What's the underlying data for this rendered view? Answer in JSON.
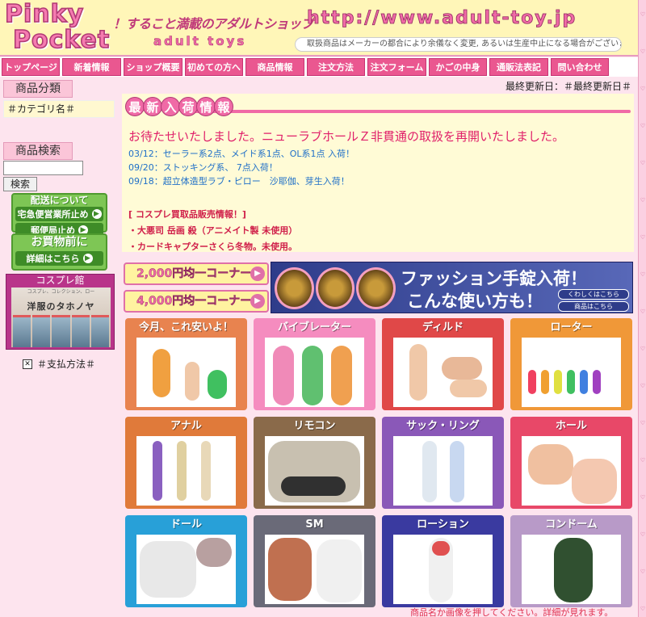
{
  "header": {
    "logo_line1": "Pinky",
    "logo_line2": "Pocket",
    "tagline": "！すること満載のアダルトショップ",
    "brand_sub": "adult toys",
    "url": "http://www.adult-toy.jp",
    "notice": "取扱商品はメーカーの都合により余儀なく変更, あるいは生産中止になる場合がございます。"
  },
  "nav": [
    {
      "label": "トップページ",
      "w": 72
    },
    {
      "label": "新着情報",
      "w": 73
    },
    {
      "label": "ショップ概要",
      "w": 73
    },
    {
      "label": "初めての方へ",
      "w": 72
    },
    {
      "label": "商品情報",
      "w": 73
    },
    {
      "label": "注文方法",
      "w": 72
    },
    {
      "label": "注文フォーム",
      "w": 73
    },
    {
      "label": "かごの中身",
      "w": 72
    },
    {
      "label": "通販法表記",
      "w": 73
    },
    {
      "label": "問い合わせ",
      "w": 72
    }
  ],
  "left": {
    "category_heading": "商品分類",
    "category_placeholder": "＃カテゴリ名＃",
    "search_heading": "商品検索",
    "search_button": "検索",
    "shipping": {
      "title": "配送について",
      "row1": "宅急便営業所止め",
      "row2": "郵便局止め"
    },
    "before": {
      "title": "お買物前に",
      "row": "詳細はこちら"
    },
    "cosplay": {
      "title": "コスプレ館",
      "image_title": "洋服のタホノヤ",
      "image_sub": "コスプレ、コレクション、ロー"
    },
    "payment": "＃支払方法＃"
  },
  "main": {
    "last_updated": "最終更新日：＃最終更新日＃",
    "news_title_chars": [
      "最",
      "新",
      "入",
      "荷",
      "情",
      "報"
    ],
    "news_headline": "お待たせいたしました。ニューラブホールＺ非貫通の取扱を再開いたしました。",
    "news_items": [
      "03/12：セーラー系2点、メイド系1点、OL系1点 入荷！",
      "09/20：ストッキング系、 7点入荷！",
      "09/18：超立体造型ラブ・ピロー　沙耶伽、芽生入荷！"
    ],
    "cosplay_news": [
      "[ コスプレ買取品販売情報！]",
      "・大悪司 岳画 殺（アニメイト製 未使用）",
      "・カードキャプターさくら冬物。未使用。"
    ],
    "corners": [
      "2,000円均一コーナー",
      "4,000円均一コーナー"
    ],
    "fashion_banner": {
      "line1": "ファッション手錠入荷！",
      "line2": "こんな使い方も！",
      "btn1": "くわしくはこちら",
      "btn2": "商品はこちら"
    },
    "categories": [
      {
        "label": "今月、これ安いよ！",
        "color": "#e8834f"
      },
      {
        "label": "バイブレーター",
        "color": "#f58cbf"
      },
      {
        "label": "ディルド",
        "color": "#e04848"
      },
      {
        "label": "ローター",
        "color": "#f09838"
      },
      {
        "label": "アナル",
        "color": "#e07a3a"
      },
      {
        "label": "リモコン",
        "color": "#8a6a4a"
      },
      {
        "label": "サック・リング",
        "color": "#8a58b8"
      },
      {
        "label": "ホール",
        "color": "#e84868"
      },
      {
        "label": "ドール",
        "color": "#28a0d8"
      },
      {
        "label": "SM",
        "color": "#6a6a78"
      },
      {
        "label": "ローション",
        "color": "#3a3aa0"
      },
      {
        "label": "コンドーム",
        "color": "#b89ac8"
      }
    ],
    "hint": "商品名か画像を押してください。詳細が見れます。"
  }
}
